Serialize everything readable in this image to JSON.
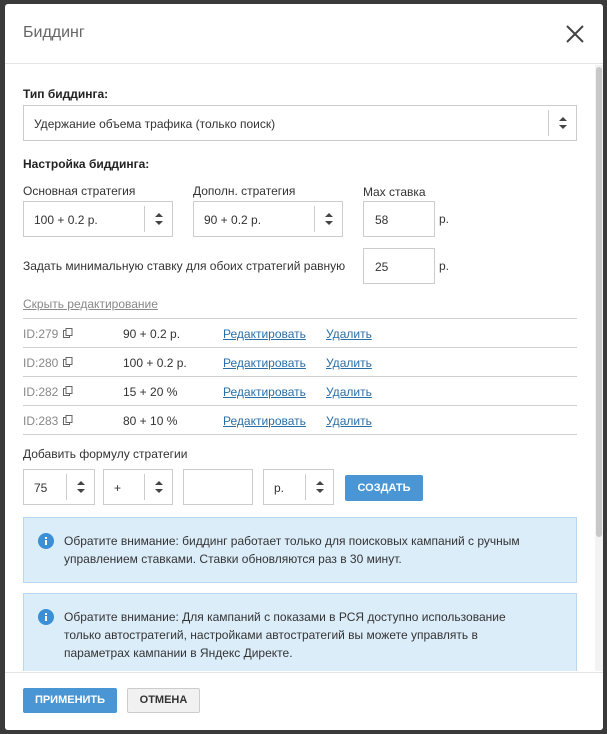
{
  "dialog": {
    "title": "Биддинг"
  },
  "bidding_type": {
    "label": "Тип биддинга:",
    "value": "Удержание объема трафика (только поиск)"
  },
  "settings": {
    "label": "Настройка биддинга:",
    "main_strategy_label": "Основная стратегия",
    "main_strategy_value": "100 + 0.2 р.",
    "extra_strategy_label": "Дополн. стратегия",
    "extra_strategy_value": "90 + 0.2 р.",
    "max_bid_label": "Max ставка",
    "max_bid_value": "58",
    "currency": "р.",
    "min_bid_label": "Задать минимальную ставку для обоих стратегий равную",
    "min_bid_value": "25"
  },
  "editing": {
    "hide_link": "Скрыть редактирование",
    "edit_label": "Редактировать",
    "delete_label": "Удалить",
    "rows": [
      {
        "id": "ID:279",
        "formula": "90 + 0.2 р."
      },
      {
        "id": "ID:280",
        "formula": "100 + 0.2 р."
      },
      {
        "id": "ID:282",
        "formula": "15 + 20 %"
      },
      {
        "id": "ID:283",
        "formula": "80 + 10 %"
      }
    ]
  },
  "add_formula": {
    "label": "Добавить формулу стратегии",
    "number_value": "75",
    "operator_value": "+",
    "amount_value": "",
    "unit_value": "р.",
    "create_button": "СОЗДАТЬ"
  },
  "notices": [
    "Обратите внимание: биддинг работает только для поисковых кампаний с ручным управлением ставками. Ставки обновляются раз в 30 минут.",
    "Обратите внимание: Для кампаний с показами в РСЯ доступно использование только автостратегий, настройками автостратегий вы можете управлять в параметрах кампании в Яндекс Директе."
  ],
  "footer": {
    "apply_button": "ПРИМЕНИТЬ",
    "cancel_button": "ОТМЕНА"
  },
  "colors": {
    "primary": "#4a95d4",
    "link": "#2a6ea6",
    "notice_bg": "#dcedfa",
    "info_icon": "#3a8fd6"
  },
  "icons": [
    "close-icon",
    "sort-arrows-icon",
    "copy-icon",
    "info-icon"
  ]
}
